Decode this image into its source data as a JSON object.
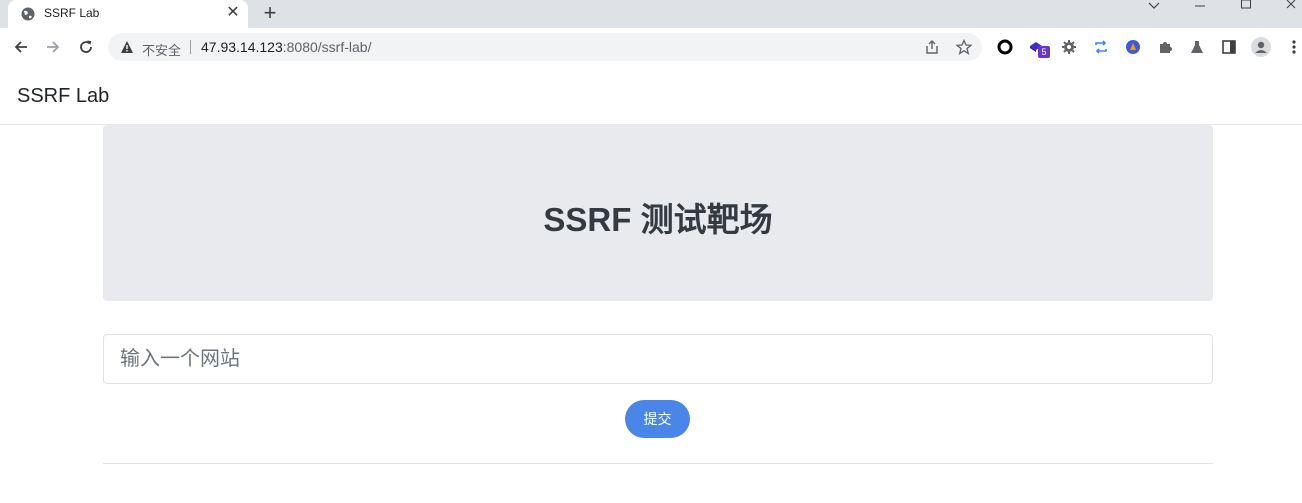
{
  "browser": {
    "tab": {
      "title": "SSRF Lab",
      "close": "✕"
    },
    "new_tab": "+",
    "security": "不安全",
    "url_host": "47.93.14.123",
    "url_rest": ":8080/ssrf-lab/",
    "extension_badge": "5"
  },
  "navbar": {
    "brand": "SSRF Lab"
  },
  "hero": {
    "title": "SSRF 测试靶场"
  },
  "form": {
    "placeholder": "输入一个网站",
    "value": "",
    "submit_label": "提交"
  },
  "colors": {
    "primary": "#4a86e8",
    "hero_bg": "#e8eaed",
    "tab_strip": "#dee1e6"
  }
}
